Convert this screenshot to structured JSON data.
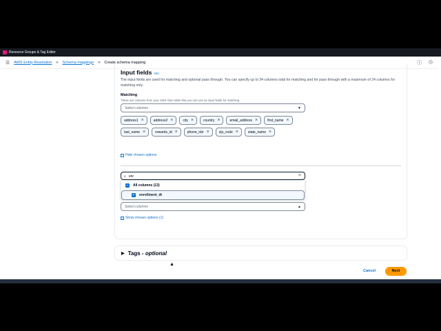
{
  "topbar": {
    "title": "Resource Groups & Tag Editor"
  },
  "breadcrumb": {
    "items": [
      "AWS Entity Resolution",
      "Schema mappings",
      "Create schema mapping"
    ],
    "sep": ">"
  },
  "section": {
    "title": "Input fields",
    "info": "Info",
    "description": "The input fields are used for matching and optional pass through. You can specify up to 34 columns total for matching and for pass through with a maximum of 24 columns for matching only."
  },
  "matching": {
    "label": "Matching",
    "description": "These are columns from your AWS Glue table that you can use as input fields for matching.",
    "placeholder": "Select columns",
    "tokens": [
      "address1",
      "address2",
      "city",
      "country",
      "email_address",
      "first_name",
      "last_name",
      "rewards_id",
      "phone_nbr",
      "zip_code",
      "state_name"
    ],
    "hide_link": "Hide chosen options"
  },
  "passthrough": {
    "search_value": "enr",
    "all_columns": "All columns (13)",
    "option": "enrollment_dt",
    "placeholder": "Select columns",
    "show_link": "Show chosen options (1)"
  },
  "tags": {
    "label": "Tags - ",
    "optional": "optional"
  },
  "actions": {
    "cancel": "Cancel",
    "next": "Next"
  }
}
